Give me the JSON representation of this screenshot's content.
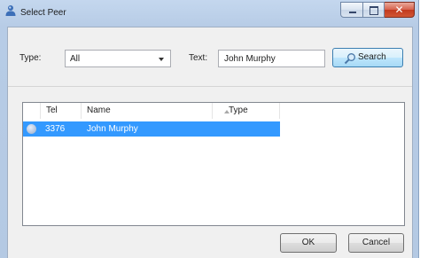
{
  "window": {
    "title": "Select Peer",
    "icon": "peer-user-icon"
  },
  "filter": {
    "type_label": "Type:",
    "type_value": "All",
    "text_label": "Text:",
    "text_value": "John Murphy",
    "search_label": "Search"
  },
  "table": {
    "columns": [
      "Tel",
      "Name",
      "Type"
    ],
    "sort_column": "Name",
    "rows": [
      {
        "tel": "3376",
        "name": "John Murphy",
        "type": "",
        "selected": true
      }
    ]
  },
  "footer": {
    "ok_label": "OK",
    "cancel_label": "Cancel"
  },
  "colors": {
    "selection": "#3399ff",
    "frame": "#b9cde6"
  }
}
